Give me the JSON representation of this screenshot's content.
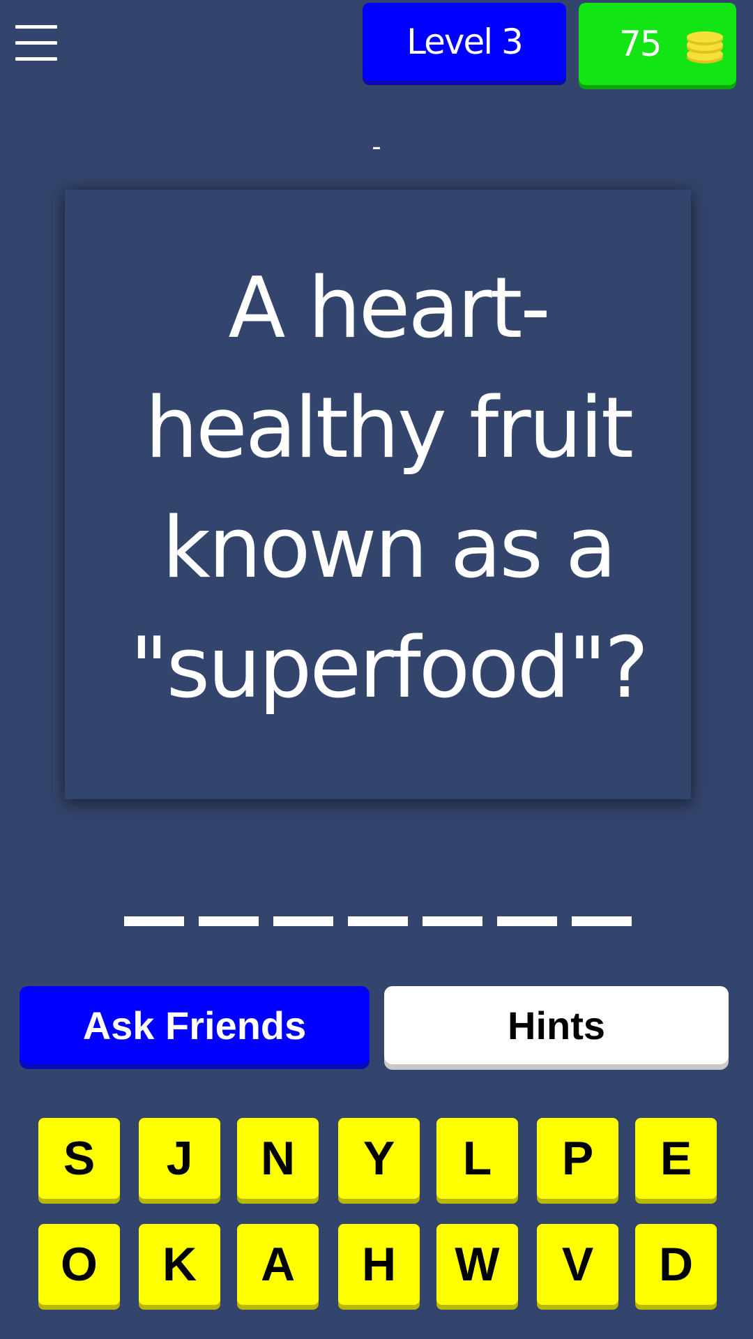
{
  "header": {
    "menu_icon": "hamburger-menu-icon",
    "level_label": "Level 3",
    "coins": "75",
    "coin_icon": "coin-stack-icon"
  },
  "progress_indicator": "-",
  "question": {
    "text": "A heart-healthy fruit known as a \"superfood\"?"
  },
  "answer": {
    "slot_count": 7
  },
  "actions": {
    "ask_friends_label": "Ask Friends",
    "hints_label": "Hints"
  },
  "letters": {
    "row1": [
      "S",
      "J",
      "N",
      "Y",
      "L",
      "P",
      "E"
    ],
    "row2": [
      "O",
      "K",
      "A",
      "H",
      "W",
      "V",
      "D"
    ]
  },
  "colors": {
    "background": "#33456c",
    "level_badge": "#0000ff",
    "coins_badge": "#13e413",
    "coin": "#f6e03a",
    "letter_key": "#ffff00",
    "ask_button": "#0000ff",
    "hints_button": "#ffffff"
  }
}
